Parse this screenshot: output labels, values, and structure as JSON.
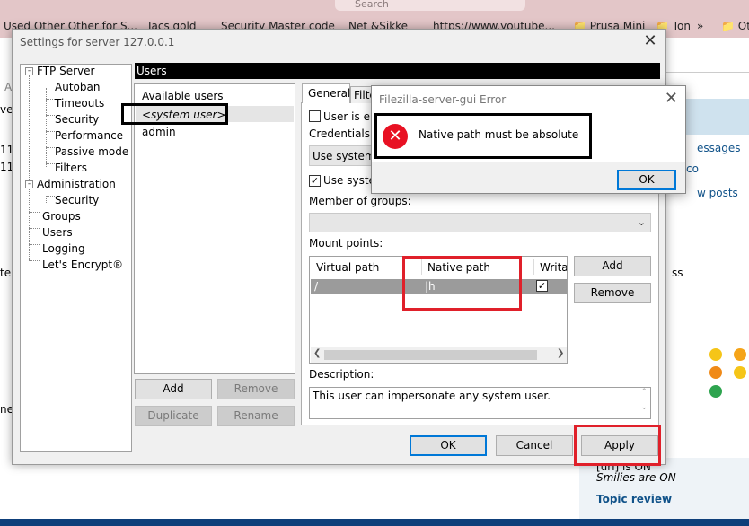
{
  "browser": {
    "search_placeholder": "Search",
    "bookmarks": [
      "Used Other Other for S...",
      "Jacs gold",
      "Security Master code",
      "Net &Sikke",
      "https://www.youtube...",
      "Prusa Mini",
      "Ton",
      "Oth"
    ],
    "chevron": "»",
    "page_fragments": {
      "left_a": "A",
      "left_rver": "ver",
      "left_11a": "11.",
      "left_11b": "11.",
      "left_te": "te",
      "left_ne": "ne",
      "right_messages": "essages",
      "right_co": "co",
      "right_posts": "w posts",
      "right_ss": "ss",
      "right_url": "[url] is ON",
      "right_smilies": "Smilies are ON",
      "right_topic_review": "Topic review"
    }
  },
  "settings": {
    "title": "Settings for server 127.0.0.1",
    "tree": {
      "ftp_server": "FTP Server",
      "autoban": "Autoban",
      "timeouts": "Timeouts",
      "security": "Security",
      "performance": "Performance",
      "passive_mode": "Passive mode",
      "filters": "Filters",
      "administration": "Administration",
      "admin_security": "Security",
      "groups": "Groups",
      "users": "Users",
      "logging": "Logging",
      "lets_encrypt": "Let's Encrypt®",
      "expand_glyph": "-"
    },
    "section_header": "Users",
    "users_list": {
      "heading": "Available users",
      "items": [
        "<system user>",
        "admin"
      ]
    },
    "list_buttons": {
      "add": "Add",
      "remove": "Remove",
      "duplicate": "Duplicate",
      "rename": "Rename"
    },
    "tabs": [
      "General",
      "Filters"
    ],
    "general": {
      "user_enabled_label": "User is enabled",
      "credentials_label": "Credentials:",
      "credentials_value": "Use system credentials",
      "use_system_label": "Use system credentials to access files",
      "member_of_groups_label": "Member of groups:",
      "mount_points_label": "Mount points:",
      "mount_columns": [
        "Virtual path",
        "Native path",
        "Writable"
      ],
      "mount_rows": [
        {
          "virtual_path": "/",
          "native_path": "|h",
          "writable_checked": true
        }
      ],
      "mount_add": "Add",
      "mount_remove": "Remove",
      "description_label": "Description:",
      "description_value": "This user can impersonate any system user."
    },
    "footer": {
      "ok": "OK",
      "cancel": "Cancel",
      "apply": "Apply"
    }
  },
  "error_dialog": {
    "title": "Filezilla-server-gui Error",
    "message": "Native path must be absolute",
    "ok": "OK"
  },
  "colors": {
    "highlight_red": "#e0202a",
    "highlight_black": "#000000",
    "error_icon": "#e81123",
    "default_button_border": "#0078d7"
  }
}
